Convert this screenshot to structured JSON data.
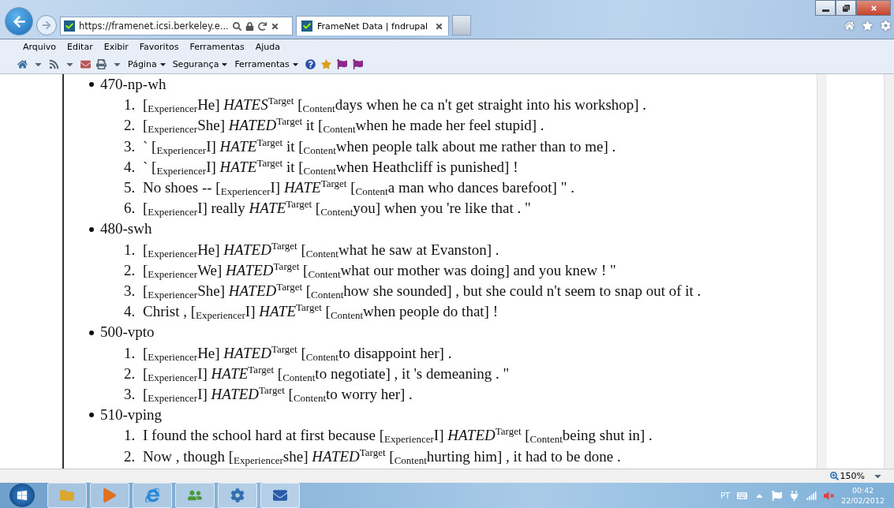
{
  "browser": {
    "address": "https://framenet.icsi.berkeley.e...",
    "tabs": [
      {
        "label": "FrameNet Data | fndrupal",
        "selected": true
      }
    ],
    "menu": [
      "Arquivo",
      "Editar",
      "Exibir",
      "Favoritos",
      "Ferramentas",
      "Ajuda"
    ],
    "commands": [
      "Página",
      "Segurança",
      "Ferramentas"
    ]
  },
  "groups": [
    {
      "heading": "470-np-wh",
      "items": [
        {
          "number": "1.",
          "text": "[$_{Experiencer}$He] *HATES*$^{Target}$ [$_{Content}$days when he ca n't get straight into his workshop] ."
        },
        {
          "number": "2.",
          "text": "[$_{Experiencer}$She] *HATED*$^{Target}$ it [$_{Content}$when he made her feel stupid] ."
        },
        {
          "number": "3.",
          "text": "` [$_{Experiencer}$I] *HATE*$^{Target}$ it [$_{Content}$when people talk about me rather than to me] ."
        },
        {
          "number": "4.",
          "text": "` [$_{Experiencer}$I] *HATE*$^{Target}$ it [$_{Content}$when Heathcliff is punished] !"
        },
        {
          "number": "5.",
          "text": "No shoes -- [$_{Experiencer}$I] *HATE*$^{Target}$ [$_{Content}$a man who dances barefoot] \" ."
        },
        {
          "number": "6.",
          "text": "[$_{Experiencer}$I] really *HATE*$^{Target}$ [$_{Content}$you] when you 're like that . \""
        }
      ]
    },
    {
      "heading": "480-swh",
      "items": [
        {
          "number": "1.",
          "text": "[$_{Experiencer}$He] *HATED*$^{Target}$ [$_{Content}$what he saw at Evanston] ."
        },
        {
          "number": "2.",
          "text": "[$_{Experiencer}$We] *HATED*$^{Target}$ [$_{Content}$what our mother was doing] and you knew ! \""
        },
        {
          "number": "3.",
          "text": "[$_{Experiencer}$She] *HATED*$^{Target}$ [$_{Content}$how she sounded] , but she could n't seem to snap out of it ."
        },
        {
          "number": "4.",
          "text": "Christ , [$_{Experiencer}$I] *HATE*$^{Target}$ [$_{Content}$when people do that] !"
        }
      ]
    },
    {
      "heading": "500-vpto",
      "items": [
        {
          "number": "1.",
          "text": "[$_{Experiencer}$He] *HATED*$^{Target}$ [$_{Content}$to disappoint her] ."
        },
        {
          "number": "2.",
          "text": "[$_{Experiencer}$I] *HATE*$^{Target}$ [$_{Content}$to negotiate] , it 's demeaning . \""
        },
        {
          "number": "3.",
          "text": "[$_{Experiencer}$I] *HATED*$^{Target}$ [$_{Content}$to worry her] ."
        }
      ]
    },
    {
      "heading": "510-vping",
      "items": [
        {
          "number": "1.",
          "text": "I found the school hard at first because [$_{Experiencer}$I] *HATED*$^{Target}$ [$_{Content}$being shut in] ."
        },
        {
          "number": "2.",
          "text": "Now , though [$_{Experiencer}$she] *HATED*$^{Target}$ [$_{Content}$hurting him] , it had to be done ."
        }
      ]
    }
  ],
  "status_bar": {
    "zoom": "150%"
  },
  "taskbar": {
    "language": "PT",
    "time": "00:42",
    "date": "22/02/2012"
  }
}
